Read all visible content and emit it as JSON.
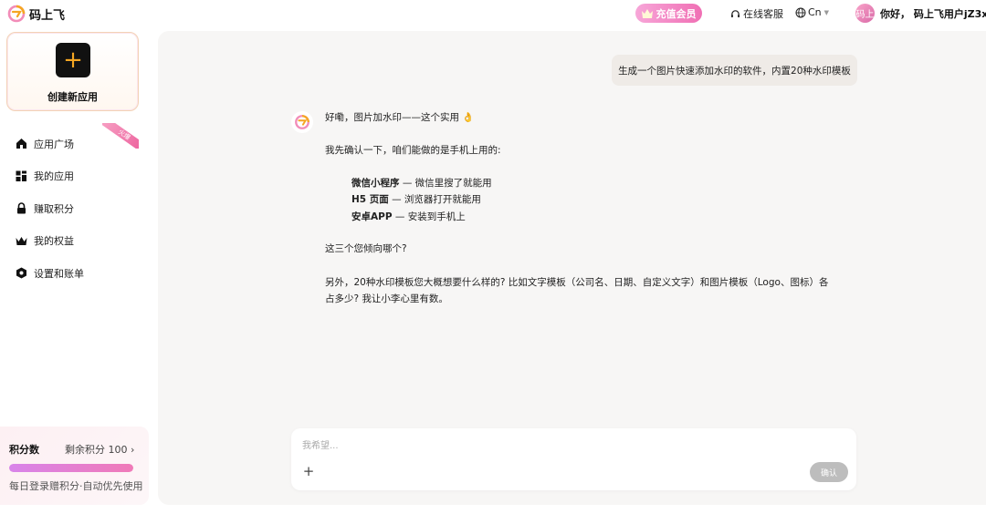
{
  "header": {
    "brand": "码上飞",
    "vip_label": "充值会员",
    "service_label": "在线客服",
    "lang_label": "Cn",
    "avatar_text": "码上",
    "user_greeting": "你好， 码上飞用户jZ3x"
  },
  "sidebar": {
    "create_label": "创建新应用",
    "badge": "火爆",
    "items": [
      {
        "label": "应用广场",
        "icon": "home-icon"
      },
      {
        "label": "我的应用",
        "icon": "grid-icon"
      },
      {
        "label": "赚取积分",
        "icon": "lock-icon"
      },
      {
        "label": "我的权益",
        "icon": "crown-icon"
      },
      {
        "label": "设置和账单",
        "icon": "settings-icon"
      }
    ],
    "points": {
      "title": "积分数",
      "remain": "剩余积分 100 ›",
      "note": "每日登录赠积分·自动优先使用",
      "fill_percent": 100
    }
  },
  "chat": {
    "user_message": "生成一个图片快速添加水印的软件，内置20种水印模板",
    "bot": {
      "l1": "好嘞，图片加水印——这个实用 👌",
      "l2": "我先确认一下，咱们能做的是手机上用的:",
      "opt1_title": "微信小程序",
      "opt1_desc": " — 微信里搜了就能用",
      "opt2_title": "H5 页面",
      "opt2_desc": " — 浏览器打开就能用",
      "opt3_title": "安卓APP",
      "opt3_desc": " — 安装到手机上",
      "l3": "这三个您倾向哪个?",
      "l4": "另外，20种水印模板您大概想要什么样的? 比如文字模板（公司名、日期、自定义文字）和图片模板（Logo、图标）各",
      "l5": "占多少? 我让小李心里有数。"
    },
    "input_placeholder": "我希望...",
    "confirm_label": "确认"
  },
  "colors": {
    "accent_pink": "#f06fb4",
    "brand_orange": "#f5a623",
    "panel_bg": "#f7f6f5"
  }
}
